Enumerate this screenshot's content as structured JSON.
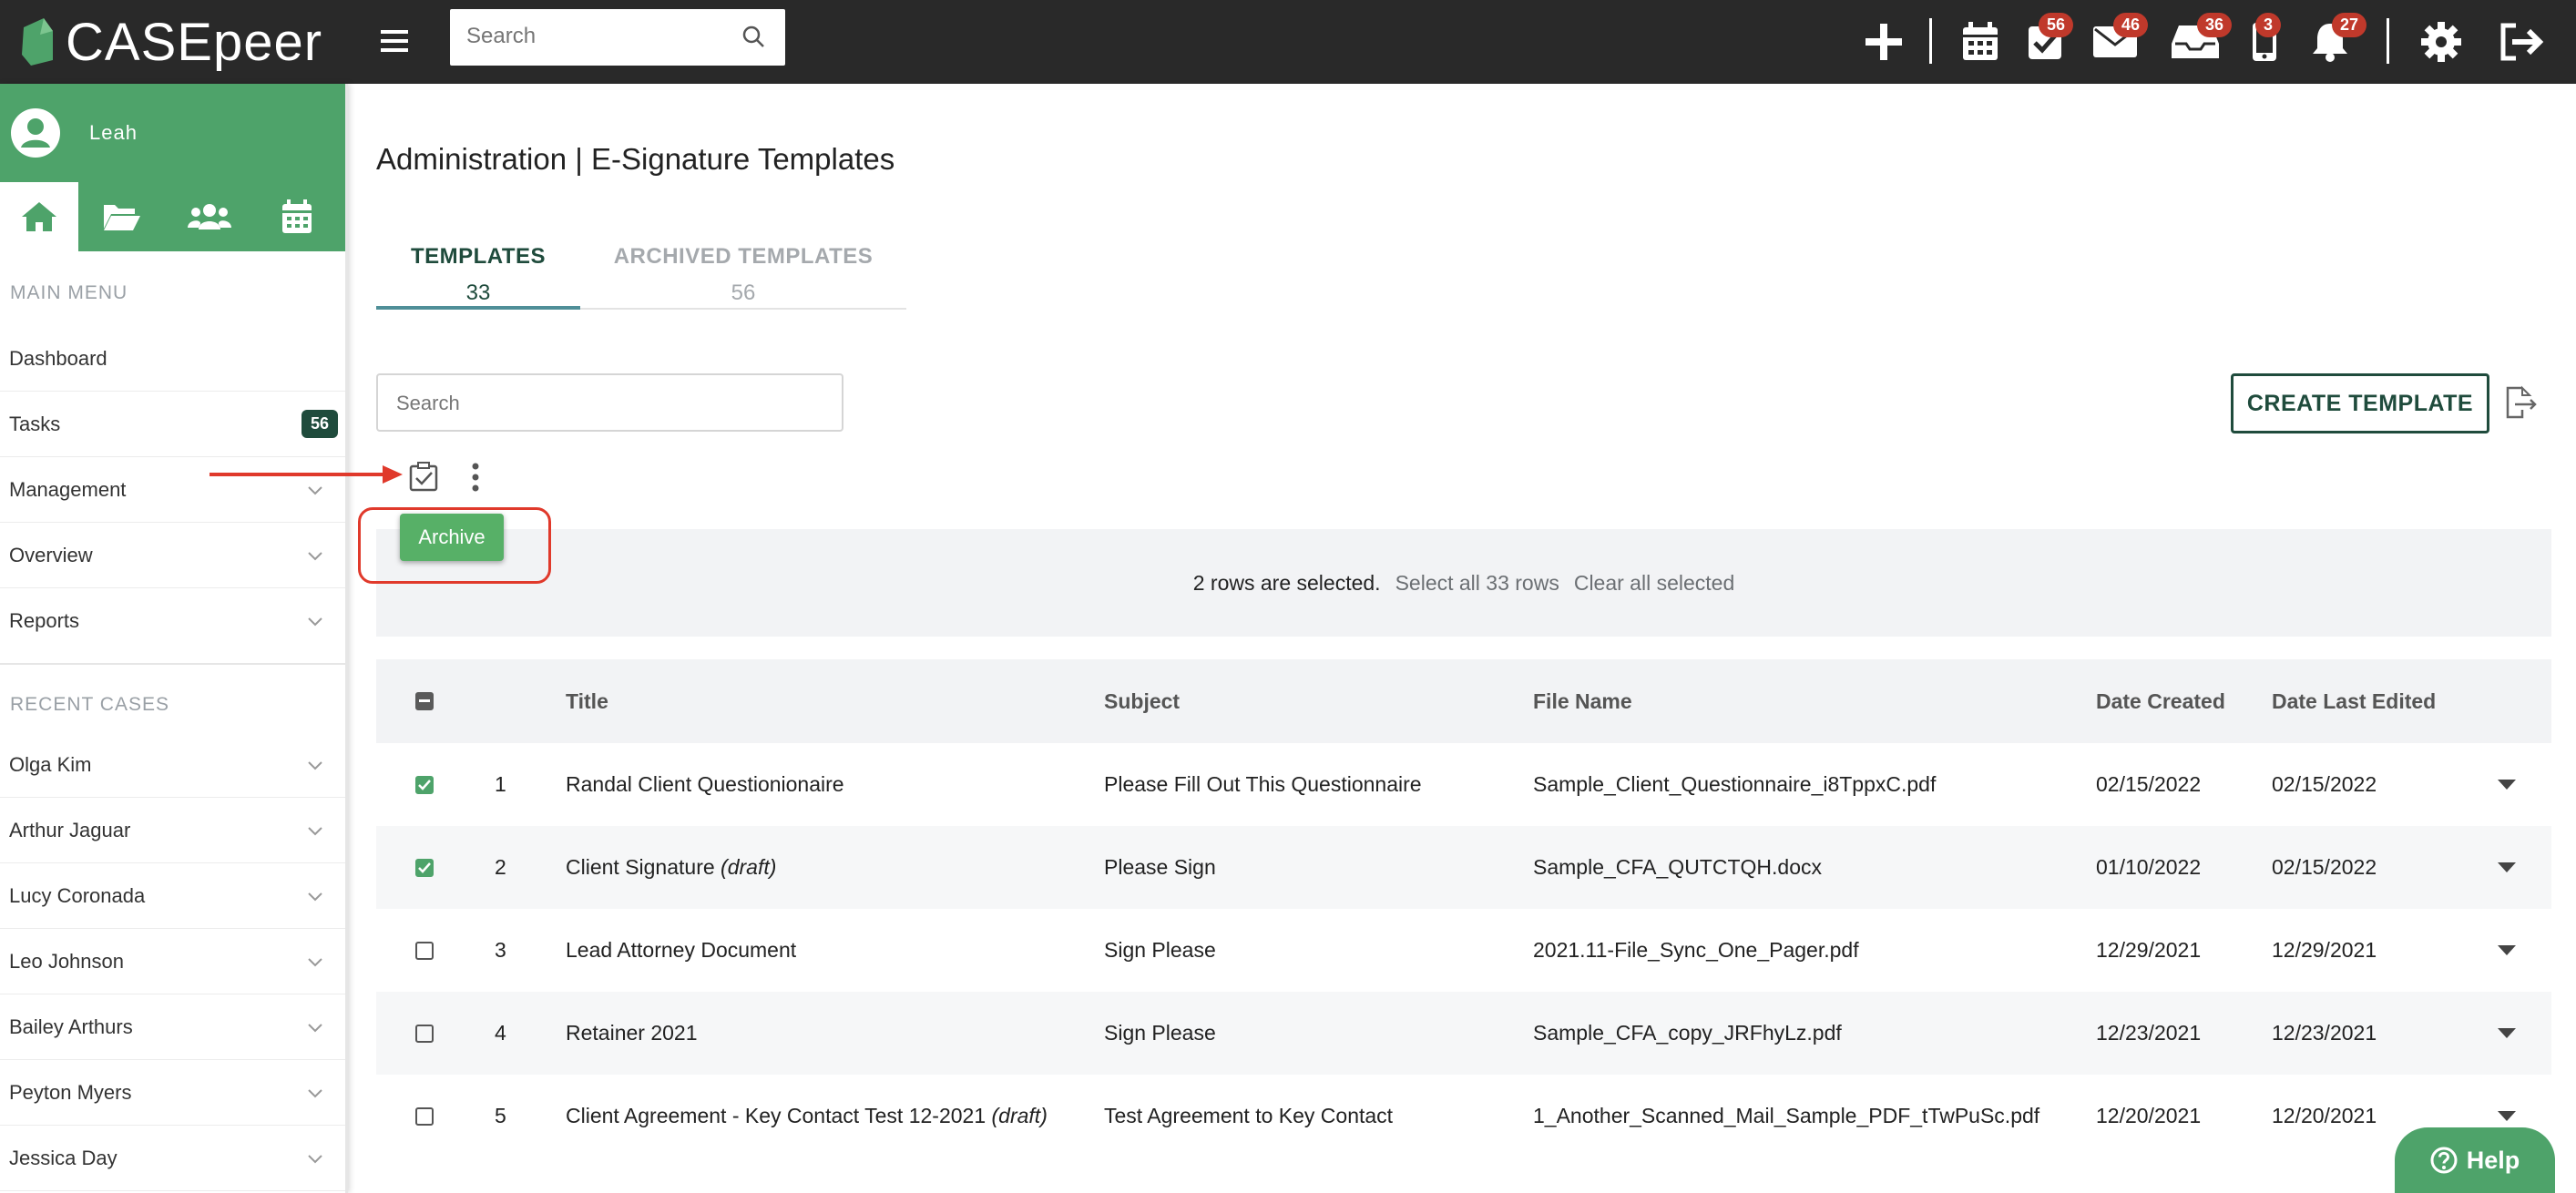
{
  "app": {
    "logo_text": "CASEpeer",
    "brand_color": "#4ea36a",
    "dark_green": "#1f4b3c"
  },
  "topbar": {
    "search_placeholder": "Search",
    "icons": [
      {
        "name": "plus-icon"
      },
      {
        "name": "calendar-icon"
      },
      {
        "name": "tasks-icon",
        "badge": "56"
      },
      {
        "name": "mail-icon",
        "badge": "46"
      },
      {
        "name": "inbox-icon",
        "badge": "36"
      },
      {
        "name": "phone-icon",
        "badge": "3"
      },
      {
        "name": "bell-icon",
        "badge": "27"
      },
      {
        "name": "gear-icon"
      },
      {
        "name": "logout-icon"
      }
    ]
  },
  "sidebar": {
    "user": "Leah",
    "main_menu_header": "MAIN MENU",
    "main_menu": [
      {
        "label": "Dashboard"
      },
      {
        "label": "Tasks",
        "count": "56"
      },
      {
        "label": "Management"
      },
      {
        "label": "Overview"
      },
      {
        "label": "Reports"
      }
    ],
    "recent_header": "RECENT CASES",
    "recent": [
      "Olga Kim",
      "Arthur Jaguar",
      "Lucy Coronada",
      "Leo Johnson",
      "Bailey Arthurs",
      "Peyton Myers",
      "Jessica Day"
    ]
  },
  "page": {
    "title": "Administration | E-Signature Templates",
    "tabs": [
      {
        "label": "TEMPLATES",
        "count": "33"
      },
      {
        "label": "ARCHIVED TEMPLATES",
        "count": "56"
      }
    ],
    "search_placeholder": "Search",
    "create_button": "CREATE TEMPLATE",
    "archive_label": "Archive",
    "selection": {
      "selected_text": "2 rows are selected.",
      "select_all": "Select all 33 rows",
      "clear": "Clear all selected"
    }
  },
  "table": {
    "headers": [
      "Title",
      "Subject",
      "File Name",
      "Date Created",
      "Date Last Edited"
    ],
    "rows": [
      {
        "num": "1",
        "title": "Randal Client Questionionaire",
        "draft": "",
        "subject": "Please Fill Out This Questionnaire",
        "file": "Sample_Client_Questionnaire_i8TppxC.pdf",
        "created": "02/15/2022",
        "edited": "02/15/2022",
        "checked": true
      },
      {
        "num": "2",
        "title": "Client Signature",
        "draft": "(draft)",
        "subject": "Please Sign",
        "file": "Sample_CFA_QUTCTQH.docx",
        "created": "01/10/2022",
        "edited": "02/15/2022",
        "checked": true
      },
      {
        "num": "3",
        "title": "Lead Attorney Document",
        "draft": "",
        "subject": "Sign Please",
        "file": "2021.11-File_Sync_One_Pager.pdf",
        "created": "12/29/2021",
        "edited": "12/29/2021",
        "checked": false
      },
      {
        "num": "4",
        "title": "Retainer 2021",
        "draft": "",
        "subject": "Sign Please",
        "file": "Sample_CFA_copy_JRFhyLz.pdf",
        "created": "12/23/2021",
        "edited": "12/23/2021",
        "checked": false
      },
      {
        "num": "5",
        "title": "Client Agreement - Key Contact Test 12-2021",
        "draft": "(draft)",
        "subject": "Test Agreement to Key Contact",
        "file": "1_Another_Scanned_Mail_Sample_PDF_tTwPuSc.pdf",
        "created": "12/20/2021",
        "edited": "12/20/2021",
        "checked": false
      }
    ]
  },
  "help_label": "Help"
}
